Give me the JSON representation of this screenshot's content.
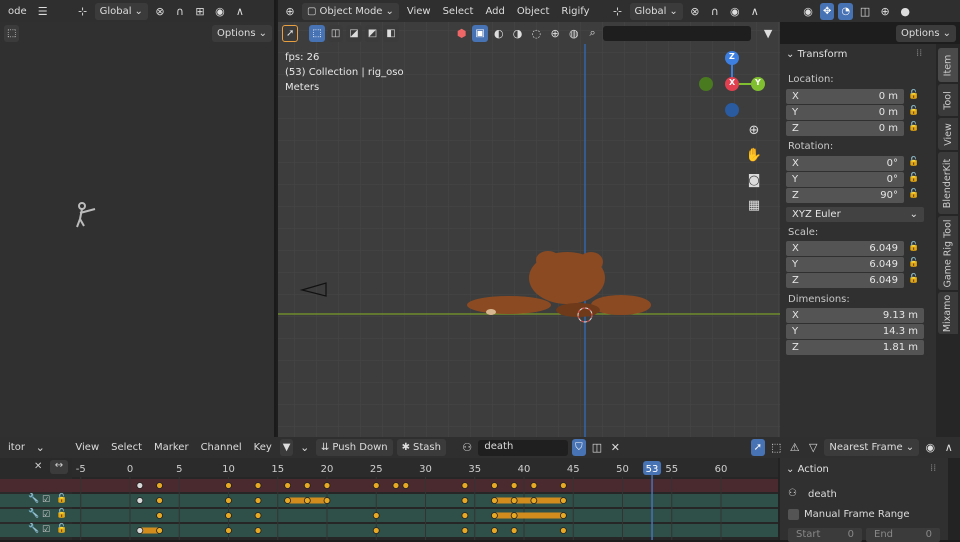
{
  "left_header": {
    "mode_fragment": "ode",
    "orientation": "Global",
    "options": "Options"
  },
  "viewport_header": {
    "mode": "Object Mode",
    "menus": [
      "View",
      "Select",
      "Add",
      "Object",
      "Rigify"
    ],
    "orientation": "Global",
    "options": "Options"
  },
  "viewport_overlay": {
    "fps": "fps: 26",
    "collection": "(53) Collection | rig_oso",
    "units": "Meters"
  },
  "gizmo": {
    "z": "Z",
    "x": "X",
    "y": "Y"
  },
  "transform": {
    "title": "Transform",
    "location_label": "Location:",
    "location": [
      {
        "axis": "X",
        "value": "0 m"
      },
      {
        "axis": "Y",
        "value": "0 m"
      },
      {
        "axis": "Z",
        "value": "0 m"
      }
    ],
    "rotation_label": "Rotation:",
    "rotation": [
      {
        "axis": "X",
        "value": "0°"
      },
      {
        "axis": "Y",
        "value": "0°"
      },
      {
        "axis": "Z",
        "value": "90°"
      }
    ],
    "rotation_mode": "XYZ Euler",
    "scale_label": "Scale:",
    "scale": [
      {
        "axis": "X",
        "value": "6.049"
      },
      {
        "axis": "Y",
        "value": "6.049"
      },
      {
        "axis": "Z",
        "value": "6.049"
      }
    ],
    "dimensions_label": "Dimensions:",
    "dimensions": [
      {
        "axis": "X",
        "value": "9.13 m"
      },
      {
        "axis": "Y",
        "value": "14.3 m"
      },
      {
        "axis": "Z",
        "value": "1.81 m"
      }
    ]
  },
  "side_tabs": [
    "Item",
    "Tool",
    "View",
    "BlenderKit",
    "Game Rig Tool",
    "Mixamo"
  ],
  "timeline_header": {
    "editor_fragment": "itor",
    "menus": [
      "View",
      "Select",
      "Marker",
      "Channel",
      "Key"
    ],
    "push_down": "Push Down",
    "stash": "Stash",
    "action_name": "death",
    "snap": "Nearest Frame"
  },
  "ruler": {
    "ticks": [
      -5,
      0,
      5,
      10,
      15,
      20,
      25,
      30,
      35,
      40,
      45,
      50,
      55,
      60
    ],
    "current_frame": 53
  },
  "keyframes": {
    "summary": [
      1,
      3,
      10,
      13,
      16,
      18,
      20,
      25,
      27,
      28,
      34,
      37,
      39,
      41,
      44
    ],
    "rows": [
      {
        "keys": [
          1,
          3,
          10,
          13,
          16,
          18,
          20,
          34,
          37,
          39,
          41,
          44
        ],
        "holds": [
          [
            16,
            20
          ],
          [
            37,
            44
          ]
        ]
      },
      {
        "keys": [
          3,
          10,
          13,
          25,
          34,
          37,
          39,
          44
        ],
        "holds": [
          [
            37,
            44
          ]
        ]
      },
      {
        "keys": [
          1,
          3,
          10,
          13,
          25,
          34,
          37,
          39,
          44
        ],
        "holds": [
          [
            1,
            3
          ]
        ]
      }
    ]
  },
  "action_panel": {
    "title": "Action",
    "action_name": "death",
    "manual_frame_range": "Manual Frame Range",
    "start_label": "Start",
    "start_value": "0",
    "end_label": "End",
    "end_value": "0"
  },
  "colors": {
    "accent": "#4772b3",
    "frame_marker": "#4772b3",
    "keyframe": "#e7a823",
    "hold": "#d18c1d"
  }
}
